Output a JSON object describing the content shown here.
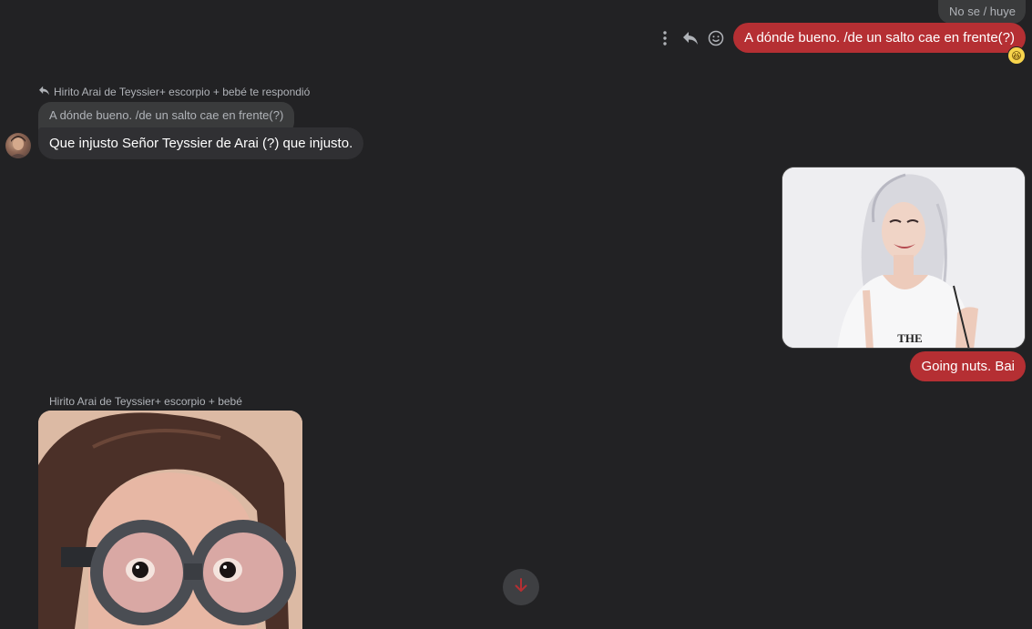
{
  "messages": {
    "top_quoted_text": "No se / huye",
    "outgoing_1": "A dónde bueno. /de un salto cae en frente(?)",
    "reaction": "😆",
    "reply_header": "Hirito Arai de Teyssier+ escorpio + bebé te respondió",
    "reply_quote": "A dónde bueno. /de un salto cae en frente(?)",
    "incoming_1": "Que injusto Señor Teyssier de Arai (?) que injusto.",
    "outgoing_2": "Going nuts. Bai",
    "sender_name": "Hirito Arai de Teyssier+ escorpio + bebé"
  },
  "photo_out": {
    "shirt_text": "THE\nECLIPSE"
  },
  "icons": [
    "more-options-icon",
    "reply-icon",
    "emoji-react-icon",
    "reply-arrow-icon",
    "arrow-down-icon"
  ],
  "colors": {
    "accent": "#b52f33",
    "background": "#222224",
    "incoming_bubble": "#303033"
  }
}
